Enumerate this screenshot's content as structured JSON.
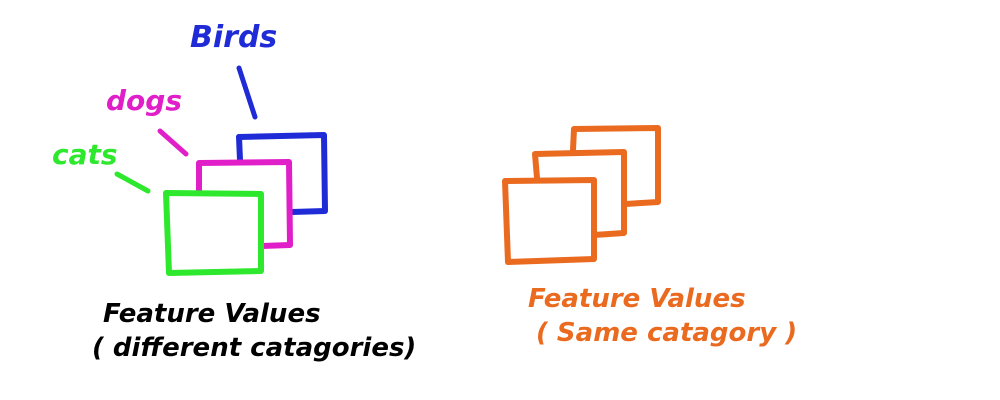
{
  "colors": {
    "background": "#ffffff",
    "birds": "#1f2bd6",
    "dogs": "#e01fc9",
    "cats": "#2ee82e",
    "same": "#ea6a20",
    "text_black": "#000000"
  },
  "left_group": {
    "labels": {
      "birds": "Birds",
      "dogs": "dogs",
      "cats": "cats"
    },
    "caption_line1": "Feature Values",
    "caption_line2": "( different catagories)"
  },
  "right_group": {
    "caption_line1": "Feature Values",
    "caption_line2": "( Same catagory )"
  }
}
